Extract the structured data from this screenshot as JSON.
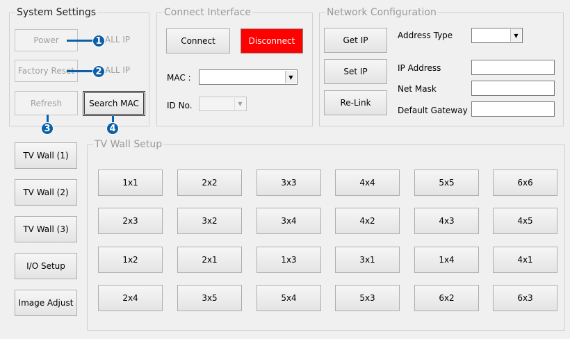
{
  "system_settings": {
    "legend": "System Settings",
    "power_label": "Power",
    "power_note": "ALL IP",
    "factory_reset_label": "Factory Reset",
    "factory_reset_note": "ALL IP",
    "refresh_label": "Refresh",
    "search_mac_label": "Search MAC"
  },
  "callouts": [
    "1",
    "2",
    "3",
    "4"
  ],
  "connect_interface": {
    "legend": "Connect Interface",
    "connect_label": "Connect",
    "disconnect_label": "Disconnect",
    "mac_label": "MAC :",
    "mac_value": "",
    "id_label": "ID No.",
    "id_value": ""
  },
  "network": {
    "legend": "Network Configuration",
    "get_ip_label": "Get IP",
    "set_ip_label": "Set IP",
    "relink_label": "Re-Link",
    "address_type_label": "Address Type",
    "address_type_value": "",
    "ip_address_label": "IP Address",
    "ip_address_value": "",
    "net_mask_label": "Net Mask",
    "net_mask_value": "",
    "gateway_label": "Default Gateway",
    "gateway_value": ""
  },
  "side_buttons": [
    "TV Wall (1)",
    "TV Wall (2)",
    "TV Wall (3)",
    "I/O Setup",
    "Image Adjust"
  ],
  "tv_wall_setup": {
    "legend": "TV Wall Setup",
    "layouts": [
      [
        "1x1",
        "2x2",
        "3x3",
        "4x4",
        "5x5",
        "6x6"
      ],
      [
        "2x3",
        "3x2",
        "3x4",
        "4x2",
        "4x3",
        "4x5"
      ],
      [
        "1x2",
        "2x1",
        "1x3",
        "3x1",
        "1x4",
        "4x1"
      ],
      [
        "2x4",
        "3x5",
        "5x4",
        "5x3",
        "6x2",
        "6x3"
      ]
    ]
  },
  "colors": {
    "accent": "#0b5fa8",
    "disconnect_bg": "#ff0000",
    "window_bg": "#f0f0f0"
  }
}
